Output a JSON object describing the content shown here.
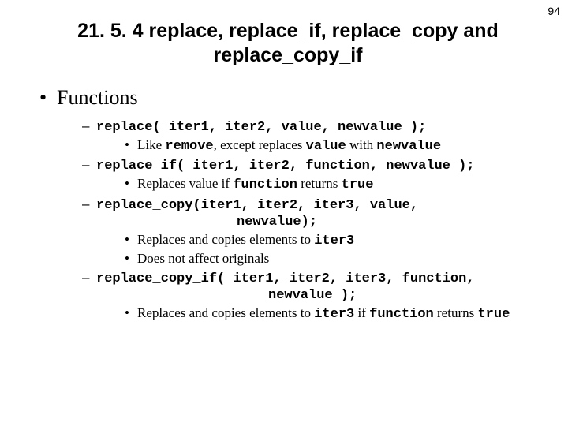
{
  "page_number": "94",
  "title": "21. 5. 4 replace, replace_if, replace_copy and replace_copy_if",
  "section": "Functions",
  "items": {
    "f1_sig": "replace( iter1, iter2, value, newvalue );",
    "f1_b1a": "Like ",
    "f1_b1b": "remove",
    "f1_b1c": ", except replaces ",
    "f1_b1d": "value",
    "f1_b1e": " with ",
    "f1_b1f": "newvalue",
    "f2_sig": "replace_if( iter1, iter2, function, newvalue );",
    "f2_b1a": "Replaces value if ",
    "f2_b1b": "function",
    "f2_b1c": " returns ",
    "f2_b1d": "true",
    "f3_sig1": "replace_copy(iter1, iter2, iter3, value,",
    "f3_sig2": "newvalue);",
    "f3_b1a": "Replaces and copies elements to ",
    "f3_b1b": "iter3",
    "f3_b2": "Does not affect originals",
    "f4_sig1": "replace_copy_if( iter1, iter2, iter3, function,",
    "f4_sig2": "newvalue );",
    "f4_b1a": "Replaces and copies elements to ",
    "f4_b1b": "iter3",
    "f4_b1c": " if ",
    "f4_b1d": "function",
    "f4_b1e": " returns ",
    "f4_b1f": "true"
  }
}
